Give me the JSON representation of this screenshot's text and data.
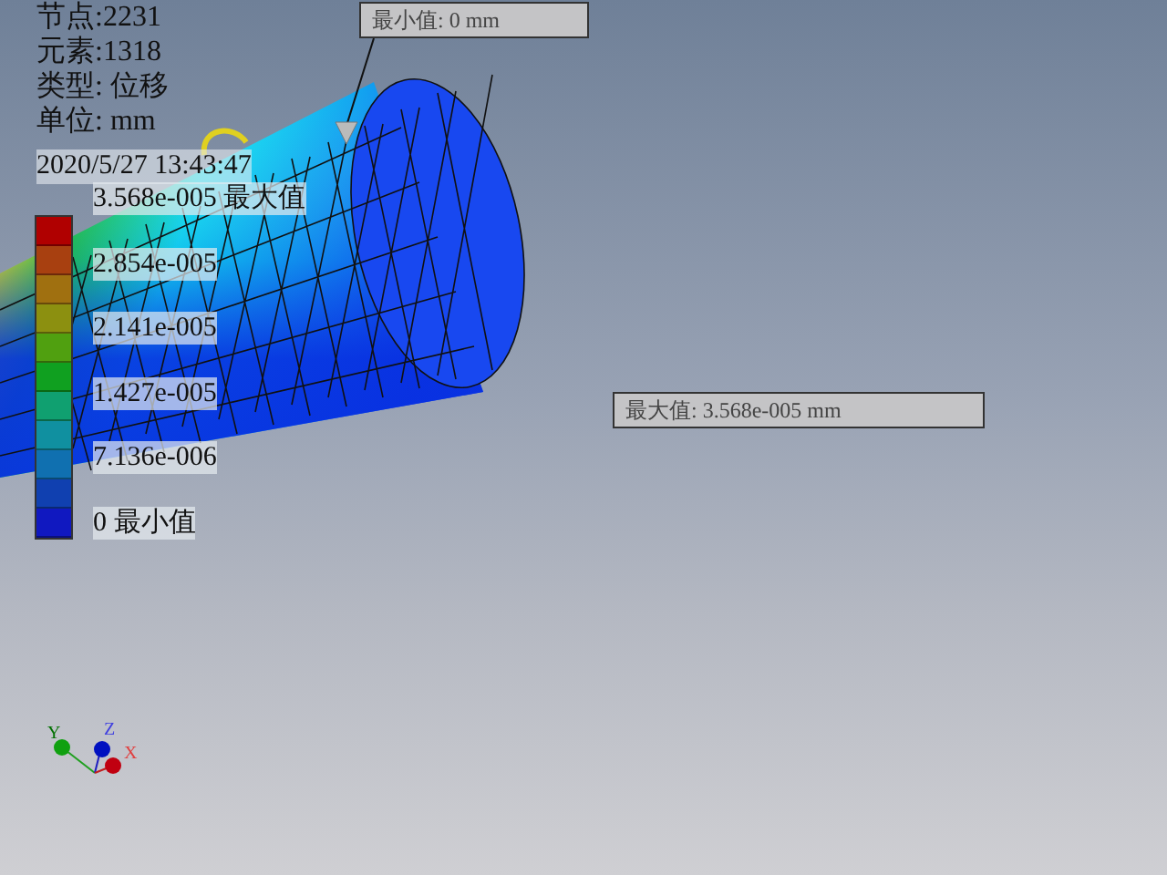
{
  "info_lines": [
    "节点:2231",
    "元素:1318",
    "类型: 位移",
    "单位: mm"
  ],
  "timestamp": "2020/5/27 13:43:47",
  "legend": {
    "labels": [
      "3.568e-005 最大值",
      "2.854e-005",
      "2.141e-005",
      "1.427e-005",
      "7.136e-006",
      "0 最小值"
    ]
  },
  "callouts": [
    {
      "kind": "min",
      "text": "最小值: 0 mm"
    },
    {
      "kind": "max",
      "text": "最大值: 3.568e-005 mm"
    }
  ],
  "triad": {
    "x": "X",
    "y": "Y",
    "z": "Z"
  }
}
